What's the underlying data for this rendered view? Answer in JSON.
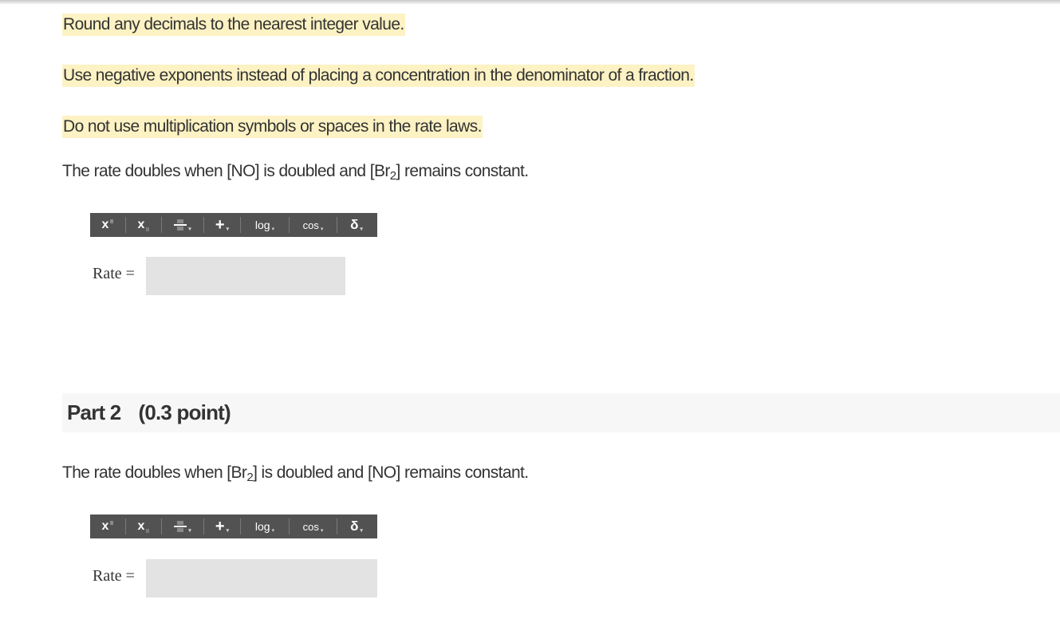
{
  "instructions": [
    "Round any decimals to the nearest integer value.",
    "Use negative exponents instead of placing a concentration in the denominator of a fraction.",
    "Do not use multiplication symbols or spaces in the rate laws."
  ],
  "parts": [
    {
      "prompt": {
        "pre": "The rate doubles when [NO] is doubled and [Br",
        "sub": "2",
        "post": "] remains constant."
      },
      "rate_label": "Rate =",
      "input_value": ""
    },
    {
      "header": {
        "title": "Part 2",
        "points": "(0.3 point)"
      },
      "prompt": {
        "pre": "The rate doubles when [Br",
        "sub": "2",
        "post": "] is doubled and [NO] remains constant."
      },
      "rate_label": "Rate =",
      "input_value": ""
    }
  ],
  "toolbar": {
    "superscript": "x",
    "subscript": "x",
    "plus": "+",
    "log": "log",
    "cos": "cos",
    "delta": "δ",
    "caret": "▾"
  },
  "colors": {
    "highlight": "#fdf2c3",
    "toolbar_bg": "#525252",
    "input_bg": "#e3e3e3",
    "part_header_bg": "#f7f7f7"
  }
}
